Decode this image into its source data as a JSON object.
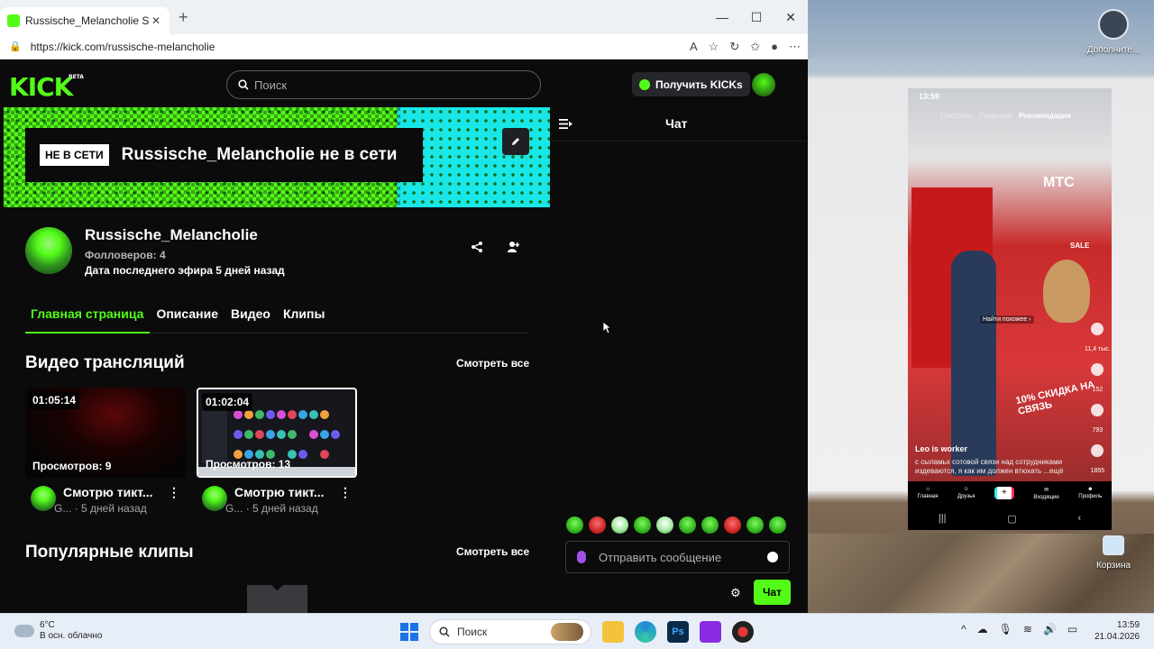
{
  "browser": {
    "tab_title": "Russische_Melancholie Stream - W",
    "url": "https://kick.com/russische-melancholie",
    "reader_icon_label": "A"
  },
  "kick": {
    "logo": "KICK",
    "logo_badge": "BETA",
    "search_placeholder": "Поиск",
    "get_kicks_label": "Получить KICKs",
    "banner": {
      "offline_badge": "НЕ В СЕТИ",
      "offline_text": "Russische_Melancholie не в сети"
    },
    "channel": {
      "name": "Russische_Melancholie",
      "followers": "Фолловеров: 4",
      "last_stream": "Дата последнего эфира 5 дней назад"
    },
    "tabs": [
      {
        "label": "Главная страница"
      },
      {
        "label": "Описание"
      },
      {
        "label": "Видео"
      },
      {
        "label": "Клипы"
      }
    ],
    "streams_section": {
      "title": "Видео трансляций",
      "see_all": "Смотреть все"
    },
    "videos": [
      {
        "duration": "01:05:14",
        "views": "Просмотров: 9",
        "title": "Смотрю тикт...",
        "channel_short": "G...",
        "age": "· 5 дней назад"
      },
      {
        "duration": "01:02:04",
        "views": "Просмотров: 13",
        "title": "Смотрю тикт...",
        "channel_short": "G...",
        "age": "· 5 дней назад"
      }
    ],
    "clips_section": {
      "title": "Популярные клипы",
      "see_all": "Смотреть все"
    },
    "chat": {
      "title": "Чат",
      "input_placeholder": "Отправить сообщение",
      "send_label": "Чат"
    },
    "colors": {
      "accent": "#53fc18",
      "background": "#0b0b0c"
    }
  },
  "desktop": {
    "top_icon_label": "Дополните...",
    "recycle_bin_label": "Корзина"
  },
  "phone": {
    "status_time": "13:59",
    "tabs": [
      "Смотреть",
      "Подписки",
      "Рекомендации"
    ],
    "caption_user": "Leo is worker",
    "caption_text": "с сыламьх сотовой связи над сотрудниками издеваются, я как им должен втюхать ...ещё",
    "search_similar": "Найти похожее",
    "sale_text": "10% СКИДКА НА СВЯЗЬ",
    "store_sign": "МТС",
    "sale_sign": "SALE",
    "likes": "11,4 тыс.",
    "comments": "152",
    "saves": "793",
    "shares": "1855",
    "nav": [
      "Главная",
      "Друзья",
      "+",
      "Входящие",
      "Профиль"
    ]
  },
  "taskbar": {
    "weather_temp": "6°C",
    "weather_desc": "В осн. облачно",
    "search_label": "Поиск",
    "time": "13:59",
    "date": "21.04.2026"
  }
}
